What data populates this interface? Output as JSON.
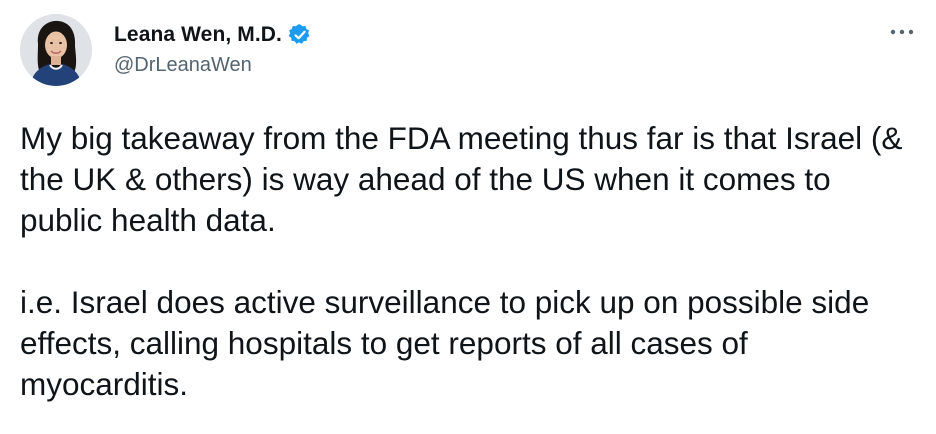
{
  "author": {
    "display_name": "Leana Wen, M.D.",
    "handle": "@DrLeanaWen",
    "verified": true,
    "avatar": "avatar-photo"
  },
  "menu": {
    "icon": "more-horizontal-icon"
  },
  "tweet": {
    "paragraphs": [
      "My big takeaway from the FDA meeting thus far is that Israel (& the UK & others) is way ahead of the US when it comes to public health data.",
      "i.e. Israel does active surveillance to pick up on possible side effects, calling hospitals to get reports of all cases of myocarditis."
    ]
  },
  "colors": {
    "text": "#0f1419",
    "secondary": "#536471",
    "verified_badge": "#1d9bf0",
    "background": "#ffffff"
  }
}
